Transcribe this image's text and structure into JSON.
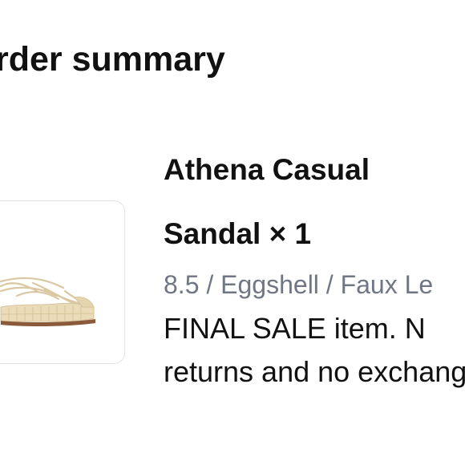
{
  "summary": {
    "heading": "rder summary"
  },
  "item": {
    "name_line1": "Athena Casual",
    "name_line2": "Sandal × 1",
    "variant": "8.5 / Eggshell / Faux Le",
    "notice": "FINAL SALE item. N returns and no exchanges.",
    "image_icon": "sandal-product-image"
  },
  "colors": {
    "text": "#111111",
    "muted": "#707684",
    "border": "#e3e3e3",
    "sandal_base": "#e8d9b5",
    "sandal_sole": "#8a5a3a"
  }
}
